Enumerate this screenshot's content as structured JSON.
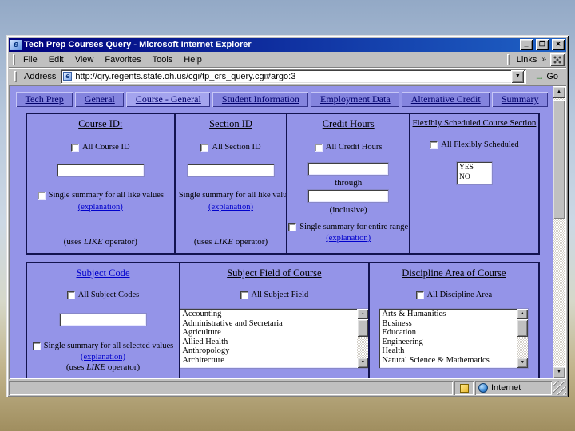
{
  "window": {
    "title": "Tech Prep Courses Query - Microsoft Internet Explorer",
    "controls": {
      "minimize": "_",
      "maximize": "❐",
      "close": "✕"
    },
    "app_icon_glyph": "e"
  },
  "menubar": {
    "items": [
      {
        "label": "File"
      },
      {
        "label": "Edit"
      },
      {
        "label": "View"
      },
      {
        "label": "Favorites"
      },
      {
        "label": "Tools"
      },
      {
        "label": "Help"
      }
    ],
    "links_label": "Links",
    "links_chevron": "»"
  },
  "addressbar": {
    "label": "Address",
    "value": "http://qry.regents.state.oh.us/cgi/tp_crs_query.cgi#argo:3",
    "go_label": "Go",
    "go_icon": "→",
    "dropdown_icon": "▼",
    "page_icon_glyph": "e"
  },
  "tabs": [
    {
      "label": "Tech Prep"
    },
    {
      "label": "General"
    },
    {
      "label": "Course - General"
    },
    {
      "label": "Student Information"
    },
    {
      "label": "Employment Data"
    },
    {
      "label": "Alternative Credit"
    },
    {
      "label": "Summary"
    }
  ],
  "form": {
    "course_id": {
      "heading": "Course ID:",
      "all_label": "All Course ID",
      "summary_label": "Single summary for all like values",
      "explanation_link": "(explanation)",
      "note_prefix": "(uses ",
      "note_keyword": "LIKE",
      "note_suffix": " operator)"
    },
    "section_id": {
      "heading": "Section ID",
      "all_label": "All Section ID",
      "summary_label": "Single summary for all like values",
      "explanation_link": "(explanation)",
      "note_prefix": "(uses ",
      "note_keyword": "LIKE",
      "note_suffix": " operator)"
    },
    "credit_hours": {
      "heading": "Credit Hours",
      "all_label": "All Credit Hours",
      "through_label": "through",
      "inclusive_label": "(inclusive)",
      "summary_label": "Single summary for entire range",
      "explanation_link": "(explanation)"
    },
    "flexibly_scheduled": {
      "heading": "Flexibly Scheduled Course Section",
      "all_label": "All Flexibly Scheduled",
      "options": [
        "YES",
        "NO"
      ]
    },
    "subject_code": {
      "heading": "Subject Code",
      "all_label": "All Subject Codes",
      "summary_label": "Single summary for all selected values",
      "explanation_link": "(explanation)",
      "note_prefix": "(uses ",
      "note_keyword": "LIKE",
      "note_suffix": " operator)"
    },
    "subject_field": {
      "heading": "Subject Field of Course",
      "all_label": "All Subject Field",
      "options": [
        "Accounting",
        "Administrative and Secretaria",
        "Agriculture",
        "Allied Health",
        "Anthropology",
        "Architecture"
      ]
    },
    "discipline_area": {
      "heading": "Discipline Area of Course",
      "all_label": "All Discipline Area",
      "options": [
        "Arts & Humanities",
        "Business",
        "Education",
        "Engineering",
        "Health",
        "Natural Science & Mathematics"
      ]
    }
  },
  "statusbar": {
    "zone": "Internet"
  },
  "icons": {
    "scroll_up": "▲",
    "scroll_down": "▼"
  },
  "colors": {
    "page_bg": "#9494e8",
    "tab_bg": "#8484de",
    "link": "#0000cc",
    "titlebar_start": "#00007d",
    "titlebar_end": "#1f62c5"
  }
}
